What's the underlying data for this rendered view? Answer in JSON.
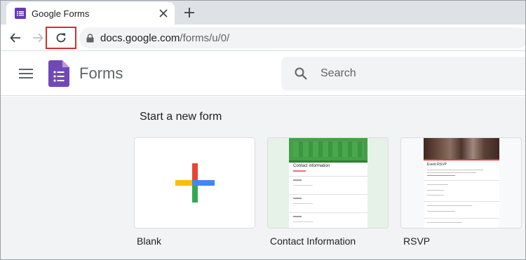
{
  "browser": {
    "tab_title": "Google Forms",
    "url_domain": "docs.google.com",
    "url_path": "/forms/u/0/",
    "highlight_color": "#d32f2f"
  },
  "app": {
    "brand": "Forms",
    "search_placeholder": "Search",
    "accent_color": "#673ab7"
  },
  "gallery": {
    "heading": "Start a new form",
    "templates": [
      {
        "label": "Blank",
        "icon": "plus-multicolor-icon"
      },
      {
        "label": "Contact Information",
        "thumb_title": "Contact information"
      },
      {
        "label": "RSVP",
        "thumb_title": "Event RSVP"
      }
    ]
  }
}
